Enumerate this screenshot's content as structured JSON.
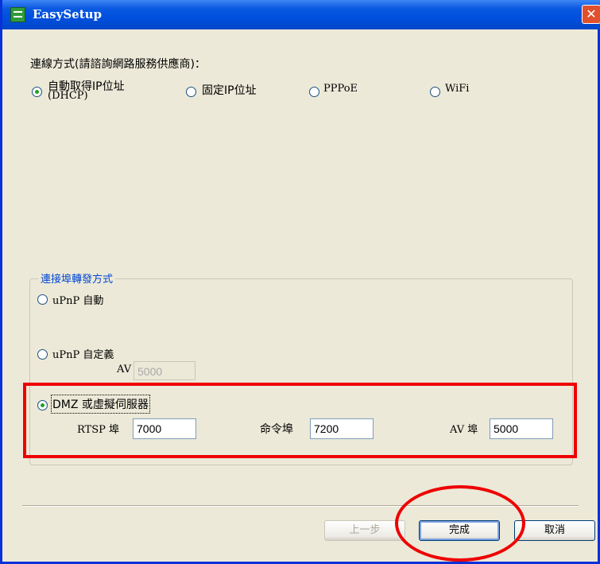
{
  "window": {
    "title": "EasySetup",
    "close_glyph": "✕"
  },
  "connection": {
    "prompt": "連線方式(請諮詢網路服務供應商)：",
    "options": [
      {
        "label": "自動取得IP位址",
        "sublabel": "(DHCP)",
        "selected": true
      },
      {
        "label": "固定IP位址",
        "selected": false
      },
      {
        "label": "PPPoE",
        "selected": false
      },
      {
        "label": "WiFi",
        "selected": false
      }
    ]
  },
  "port_forwarding": {
    "group_title": "連接埠轉發方式",
    "upnp_auto": {
      "label": "uPnP 自動",
      "selected": false
    },
    "upnp_custom": {
      "label": "uPnP 自定義",
      "selected": false,
      "av_label": "AV",
      "av_value": "5000"
    },
    "dmz": {
      "label": "DMZ 或虛擬伺服器",
      "selected": true,
      "rtsp_label": "RTSP 埠",
      "rtsp_value": "7000",
      "command_label": "命令埠",
      "command_value": "7200",
      "av_label": "AV 埠",
      "av_value": "5000"
    }
  },
  "footer": {
    "prev_label": "上一步",
    "finish_label": "完成",
    "cancel_label": "取消"
  },
  "colors": {
    "titlebar": "#0a58e0",
    "window_bg": "#ece9d8",
    "group_title": "#0046d5",
    "annotation_red": "#ee0000"
  }
}
